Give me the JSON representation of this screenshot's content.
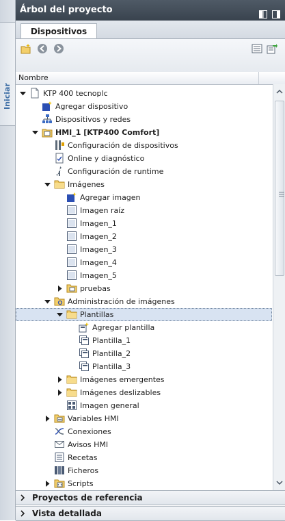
{
  "side_tab": {
    "label": "Iniciar"
  },
  "panel": {
    "title": "Árbol del proyecto",
    "tab_label": "Dispositivos"
  },
  "header": {
    "column_name": "Nombre"
  },
  "tree": [
    {
      "label": "KTP 400 tecnoplc",
      "icon": "project-icon",
      "level": 0,
      "expander": "expanded",
      "bold": false,
      "selected": false
    },
    {
      "label": "Agregar dispositivo",
      "icon": "add-device-icon",
      "level": 1,
      "expander": "none",
      "bold": false,
      "selected": false
    },
    {
      "label": "Dispositivos y redes",
      "icon": "network-icon",
      "level": 1,
      "expander": "none",
      "bold": false,
      "selected": false
    },
    {
      "label": "HMI_1 [KTP400 Comfort]",
      "icon": "hmi-device-icon",
      "level": 1,
      "expander": "expanded",
      "bold": true,
      "selected": false
    },
    {
      "label": "Configuración de dispositivos",
      "icon": "device-config-icon",
      "level": 2,
      "expander": "none",
      "bold": false,
      "selected": false
    },
    {
      "label": "Online y diagnóstico",
      "icon": "online-diagnostic-icon",
      "level": 2,
      "expander": "none",
      "bold": false,
      "selected": false
    },
    {
      "label": "Configuración de runtime",
      "icon": "runtime-config-icon",
      "level": 2,
      "expander": "none",
      "bold": false,
      "selected": false
    },
    {
      "label": "Imágenes",
      "icon": "folder-icon",
      "level": 2,
      "expander": "expanded",
      "bold": false,
      "selected": false
    },
    {
      "label": "Agregar imagen",
      "icon": "add-screen-icon",
      "level": 3,
      "expander": "none",
      "bold": false,
      "selected": false
    },
    {
      "label": "Imagen raíz",
      "icon": "screen-icon",
      "level": 3,
      "expander": "none",
      "bold": false,
      "selected": false
    },
    {
      "label": "Imagen_1",
      "icon": "screen-icon",
      "level": 3,
      "expander": "none",
      "bold": false,
      "selected": false
    },
    {
      "label": "Imagen_2",
      "icon": "screen-icon",
      "level": 3,
      "expander": "none",
      "bold": false,
      "selected": false
    },
    {
      "label": "Imagen_3",
      "icon": "screen-icon",
      "level": 3,
      "expander": "none",
      "bold": false,
      "selected": false
    },
    {
      "label": "Imagen_4",
      "icon": "screen-icon",
      "level": 3,
      "expander": "none",
      "bold": false,
      "selected": false
    },
    {
      "label": "Imagen_5",
      "icon": "screen-icon",
      "level": 3,
      "expander": "none",
      "bold": false,
      "selected": false
    },
    {
      "label": "pruebas",
      "icon": "screen-folder-icon",
      "level": 3,
      "expander": "collapsed",
      "bold": false,
      "selected": false
    },
    {
      "label": "Administración de imágenes",
      "icon": "screen-management-icon",
      "level": 2,
      "expander": "expanded",
      "bold": false,
      "selected": false
    },
    {
      "label": "Plantillas",
      "icon": "folder-icon",
      "level": 3,
      "expander": "expanded",
      "bold": false,
      "selected": true
    },
    {
      "label": "Agregar plantilla",
      "icon": "add-template-icon",
      "level": 4,
      "expander": "none",
      "bold": false,
      "selected": false
    },
    {
      "label": "Plantilla_1",
      "icon": "template-icon",
      "level": 4,
      "expander": "none",
      "bold": false,
      "selected": false
    },
    {
      "label": "Plantilla_2",
      "icon": "template-icon",
      "level": 4,
      "expander": "none",
      "bold": false,
      "selected": false
    },
    {
      "label": "Plantilla_3",
      "icon": "template-icon",
      "level": 4,
      "expander": "none",
      "bold": false,
      "selected": false
    },
    {
      "label": "Imágenes emergentes",
      "icon": "folder-icon",
      "level": 3,
      "expander": "collapsed",
      "bold": false,
      "selected": false
    },
    {
      "label": "Imágenes deslizables",
      "icon": "folder-icon",
      "level": 3,
      "expander": "collapsed",
      "bold": false,
      "selected": false
    },
    {
      "label": "Imagen general",
      "icon": "overview-screen-icon",
      "level": 3,
      "expander": "none",
      "bold": false,
      "selected": false
    },
    {
      "label": "Variables HMI",
      "icon": "hmi-tags-icon",
      "level": 2,
      "expander": "collapsed",
      "bold": false,
      "selected": false
    },
    {
      "label": "Conexiones",
      "icon": "connections-icon",
      "level": 2,
      "expander": "none",
      "bold": false,
      "selected": false
    },
    {
      "label": "Avisos HMI",
      "icon": "alarms-icon",
      "level": 2,
      "expander": "none",
      "bold": false,
      "selected": false
    },
    {
      "label": "Recetas",
      "icon": "recipes-icon",
      "level": 2,
      "expander": "none",
      "bold": false,
      "selected": false
    },
    {
      "label": "Ficheros",
      "icon": "logs-icon",
      "level": 2,
      "expander": "none",
      "bold": false,
      "selected": false
    },
    {
      "label": "Scripts",
      "icon": "scripts-icon",
      "level": 2,
      "expander": "collapsed",
      "bold": false,
      "selected": false
    }
  ],
  "bottom_sections": [
    {
      "label": "Proyectos de referencia"
    },
    {
      "label": "Vista detallada"
    }
  ]
}
